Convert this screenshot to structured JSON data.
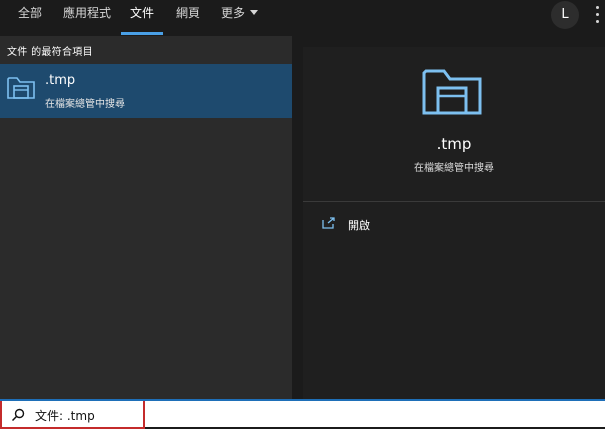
{
  "tabs": [
    {
      "label": "全部"
    },
    {
      "label": "應用程式"
    },
    {
      "label": "文件"
    },
    {
      "label": "網頁"
    },
    {
      "label": "更多"
    }
  ],
  "active_tab": "文件",
  "account": {
    "initial": "L"
  },
  "results": {
    "section_header": "文件 的最符合項目",
    "items": [
      {
        "title": ".tmp",
        "subtitle": "在檔案總管中搜尋",
        "icon": "folder-explorer-icon"
      }
    ]
  },
  "preview": {
    "title": ".tmp",
    "subtitle": "在檔案總管中搜尋",
    "icon": "folder-explorer-icon",
    "actions": [
      {
        "label": "開啟",
        "icon": "open-external-icon"
      }
    ]
  },
  "search": {
    "value": "文件: .tmp",
    "icon": "search-icon"
  },
  "colors": {
    "accent": "#4aa0e6",
    "selected_row": "#1e4a6e",
    "highlight_border": "#c42b2b"
  }
}
